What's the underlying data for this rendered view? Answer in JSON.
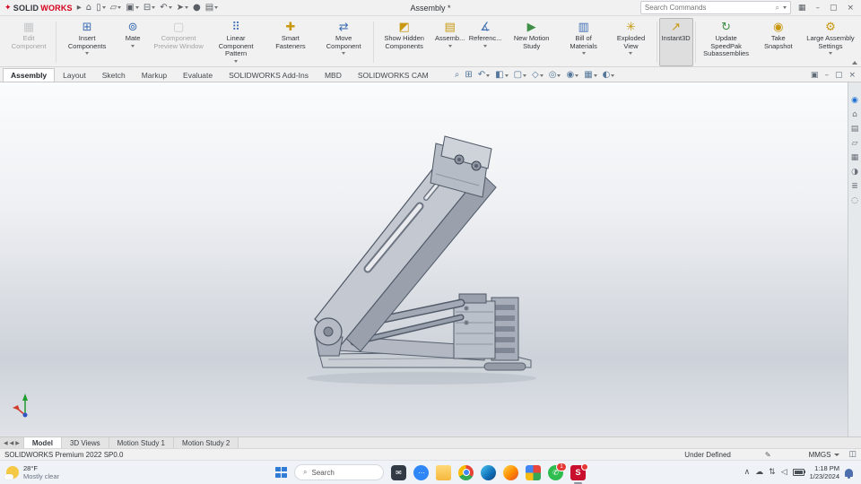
{
  "titlebar": {
    "logo_mark": "✦",
    "logo_solid": "SOLID",
    "logo_works": "WORKS",
    "nav_arrow": "▸",
    "doc_title": "Assembly *",
    "search_placeholder": "Search Commands",
    "search_magnifier": "⌕",
    "quick_icons": [
      {
        "name": "home-icon",
        "glyph": "⌂"
      },
      {
        "name": "new-document-icon",
        "glyph": "▯"
      },
      {
        "name": "open-document-icon",
        "glyph": "▱"
      },
      {
        "name": "save-icon",
        "glyph": "▣"
      },
      {
        "name": "print-icon",
        "glyph": "⊟"
      },
      {
        "name": "undo-icon",
        "glyph": "↶"
      },
      {
        "name": "select-icon",
        "glyph": "➤"
      },
      {
        "name": "sketch-ink-icon",
        "glyph": "●"
      },
      {
        "name": "options-icon",
        "glyph": "▤"
      }
    ],
    "window_icons": [
      {
        "name": "apps-grid-icon",
        "glyph": "▦"
      },
      {
        "name": "minimize-icon",
        "glyph": "–"
      },
      {
        "name": "restore-icon",
        "glyph": "▢"
      },
      {
        "name": "close-icon",
        "glyph": "×"
      }
    ]
  },
  "ribbon": {
    "buttons": [
      {
        "label": "Edit Component",
        "glyph": "▦"
      },
      {
        "label": "Insert Components",
        "glyph": "⊞"
      },
      {
        "label": "Mate",
        "glyph": "⊚"
      },
      {
        "label": "Component Preview Window",
        "glyph": "▢"
      },
      {
        "label": "Linear Component Pattern",
        "glyph": "⠿"
      },
      {
        "label": "Smart Fasteners",
        "glyph": "✚"
      },
      {
        "label": "Move Component",
        "glyph": "⇄"
      },
      {
        "label": "Show Hidden Components",
        "glyph": "◩"
      },
      {
        "label": "Assemb...",
        "glyph": "▤"
      },
      {
        "label": "Referenc...",
        "glyph": "∡"
      },
      {
        "label": "New Motion Study",
        "glyph": "▶"
      },
      {
        "label": "Bill of Materials",
        "glyph": "▥"
      },
      {
        "label": "Exploded View",
        "glyph": "✳"
      },
      {
        "label": "Instant3D",
        "glyph": "↗"
      },
      {
        "label": "Update SpeedPak Subassemblies",
        "glyph": "↻"
      },
      {
        "label": "Take Snapshot",
        "glyph": "◉"
      },
      {
        "label": "Large Assembly Settings",
        "glyph": "⚙"
      }
    ]
  },
  "tabs": [
    {
      "label": "Assembly"
    },
    {
      "label": "Layout"
    },
    {
      "label": "Sketch"
    },
    {
      "label": "Markup"
    },
    {
      "label": "Evaluate"
    },
    {
      "label": "SOLIDWORKS Add-Ins"
    },
    {
      "label": "MBD"
    },
    {
      "label": "SOLIDWORKS CAM"
    }
  ],
  "viewtools": [
    {
      "name": "zoom-fit-icon",
      "glyph": "⌕"
    },
    {
      "name": "zoom-area-icon",
      "glyph": "⊞"
    },
    {
      "name": "previous-view-icon",
      "glyph": "↶"
    },
    {
      "name": "section-view-icon",
      "glyph": "◧"
    },
    {
      "name": "view-orientation-icon",
      "glyph": "▢"
    },
    {
      "name": "display-style-icon",
      "glyph": "◇"
    },
    {
      "name": "hide-show-items-icon",
      "glyph": "◎"
    },
    {
      "name": "edit-appearance-icon",
      "glyph": "◉"
    },
    {
      "name": "apply-scene-icon",
      "glyph": "▦"
    },
    {
      "name": "view-settings-icon",
      "glyph": "◐"
    }
  ],
  "doc_window_icons": [
    {
      "name": "new-window-icon",
      "glyph": "▣"
    },
    {
      "name": "minimize-doc-icon",
      "glyph": "–"
    },
    {
      "name": "restore-doc-icon",
      "glyph": "▢"
    },
    {
      "name": "close-doc-icon",
      "glyph": "×"
    }
  ],
  "taskpane": [
    {
      "name": "solidworks-resources-icon",
      "glyph": "◉"
    },
    {
      "name": "home-icon",
      "glyph": "⌂"
    },
    {
      "name": "design-library-icon",
      "glyph": "▤"
    },
    {
      "name": "file-explorer-icon",
      "glyph": "▱"
    },
    {
      "name": "view-palette-icon",
      "glyph": "▦"
    },
    {
      "name": "appearances-icon",
      "glyph": "◑"
    },
    {
      "name": "custom-properties-icon",
      "glyph": "≣"
    },
    {
      "name": "forum-icon",
      "glyph": "◌"
    }
  ],
  "bottom_tabs": {
    "nav": [
      {
        "glyph": "◀"
      },
      {
        "glyph": "◀"
      },
      {
        "glyph": "▶"
      }
    ],
    "tabs": [
      {
        "label": "Model"
      },
      {
        "label": "3D Views"
      },
      {
        "label": "Motion Study 1"
      },
      {
        "label": "Motion Study 2"
      }
    ]
  },
  "statusbar": {
    "product": "SOLIDWORKS Premium 2022 SP0.0",
    "state": "Under Defined",
    "edit_glyph": "✎",
    "units": "MMGS",
    "panel_glyph": "◫"
  },
  "taskbar": {
    "weather_temp": "28°F",
    "weather_desc": "Mostly clear",
    "search_label": "Search",
    "search_magnifier": "⌕",
    "apps": [
      {
        "name": "mail-app-icon",
        "glyph": "✉"
      },
      {
        "name": "chat-app-icon",
        "glyph": "⋯"
      },
      {
        "name": "file-explorer-icon"
      },
      {
        "name": "chrome-icon"
      },
      {
        "name": "edge-icon"
      },
      {
        "name": "firefox-icon"
      },
      {
        "name": "photos-icon"
      },
      {
        "name": "whatsapp-icon",
        "glyph": "✆",
        "badge": "1"
      },
      {
        "name": "solidworks-icon",
        "glyph": "S"
      }
    ],
    "tray": {
      "caret": "∧",
      "cloud": "☁",
      "network": "⇅",
      "volume": "◁",
      "time": "1:18 PM",
      "date": "1/23/2024"
    }
  },
  "accent_colors": {
    "solidworks_red": "#c8102e",
    "selection_blue": "#2f7cd6"
  }
}
